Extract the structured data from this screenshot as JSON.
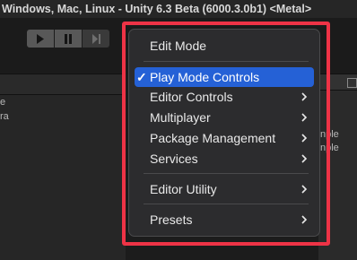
{
  "window": {
    "title": "Windows, Mac, Linux - Unity 6.3 Beta (6000.3.0b1) <Metal>"
  },
  "toolbar": {
    "play_icon": "play-icon",
    "pause_icon": "pause-icon",
    "step_icon": "step-icon"
  },
  "background": {
    "left_panel_rows": [
      "e",
      "ra"
    ],
    "right_panel_rows": [
      "nple",
      "nple"
    ]
  },
  "menu": {
    "items": [
      {
        "label": "Edit Mode",
        "checked": false,
        "submenu": false
      },
      {
        "label": "Play Mode Controls",
        "checked": true,
        "submenu": false
      },
      {
        "label": "Editor Controls",
        "checked": false,
        "submenu": true
      },
      {
        "label": "Multiplayer",
        "checked": false,
        "submenu": true
      },
      {
        "label": "Package Management",
        "checked": false,
        "submenu": true
      },
      {
        "label": "Services",
        "checked": false,
        "submenu": true
      },
      {
        "label": "Editor Utility",
        "checked": false,
        "submenu": true
      },
      {
        "label": "Presets",
        "checked": false,
        "submenu": true
      }
    ],
    "check_glyph": "✓"
  },
  "colors": {
    "highlight": "#ee3346",
    "selection": "#2561d6",
    "menu_background": "#2c2c2e"
  }
}
